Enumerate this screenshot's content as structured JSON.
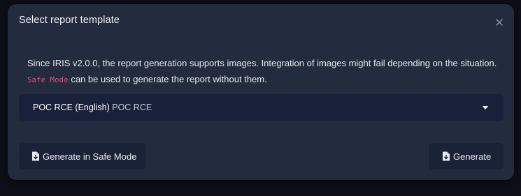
{
  "modal": {
    "title": "Select report template",
    "close_icon": "close-icon"
  },
  "message": {
    "line1": "Since IRIS v2.0.0, the report generation supports images. Integration of images might fail depending on the situation.",
    "code": "Safe Mode",
    "line2_rest": " can be used to generate the report without them."
  },
  "template_select": {
    "selected_name": "POC RCE (English)",
    "selected_description": "POC RCE",
    "caret_icon": "caret-down-icon"
  },
  "buttons": {
    "safe_mode_label": "Generate in Safe Mode",
    "generate_label": "Generate",
    "icon": "file-download-icon"
  },
  "colors": {
    "modal_bg": "#232b3e",
    "select_bg": "#19213a",
    "button_bg": "#1a2237",
    "code_color": "#e2508c"
  }
}
